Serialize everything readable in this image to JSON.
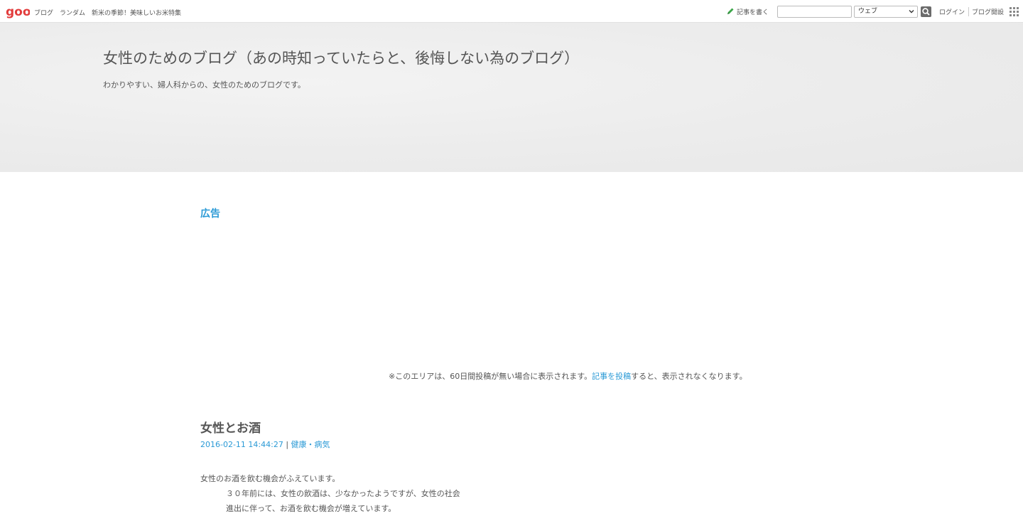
{
  "topbar": {
    "logo_text": "goo",
    "nav": [
      "ブログ",
      "ランダム",
      "新米の季節！美味しいお米特集"
    ],
    "write_label": "記事を書く",
    "search_value": "",
    "search_select_value": "ウェブ",
    "login_label": "ログイン",
    "open_blog_label": "ブログ開設"
  },
  "header": {
    "title": "女性のためのブログ（あの時知っていたらと、後悔しない為のブログ）",
    "description": "わかりやすい、婦人科からの、女性のためのブログです。"
  },
  "ad": {
    "label": "広告",
    "notice_before": "※このエリアは、60日間投稿が無い場合に表示されます。",
    "notice_link": "記事を投稿",
    "notice_after": "すると、表示されなくなります。"
  },
  "entry": {
    "title": "女性とお酒",
    "date": "2016-02-11 14:44:27",
    "separator": " | ",
    "category": "健康・病気",
    "lines": [
      "女性のお酒を飲む機会がふえています。",
      "３０年前には、女性の飲酒は、少なかったようですが、女性の社会",
      "進出に伴って、お酒を飲む機会が増えています。"
    ]
  },
  "colors": {
    "accent": "#2b9ad6",
    "logo_red": "#e23c3c",
    "write_icon_green": "#3aa648"
  }
}
